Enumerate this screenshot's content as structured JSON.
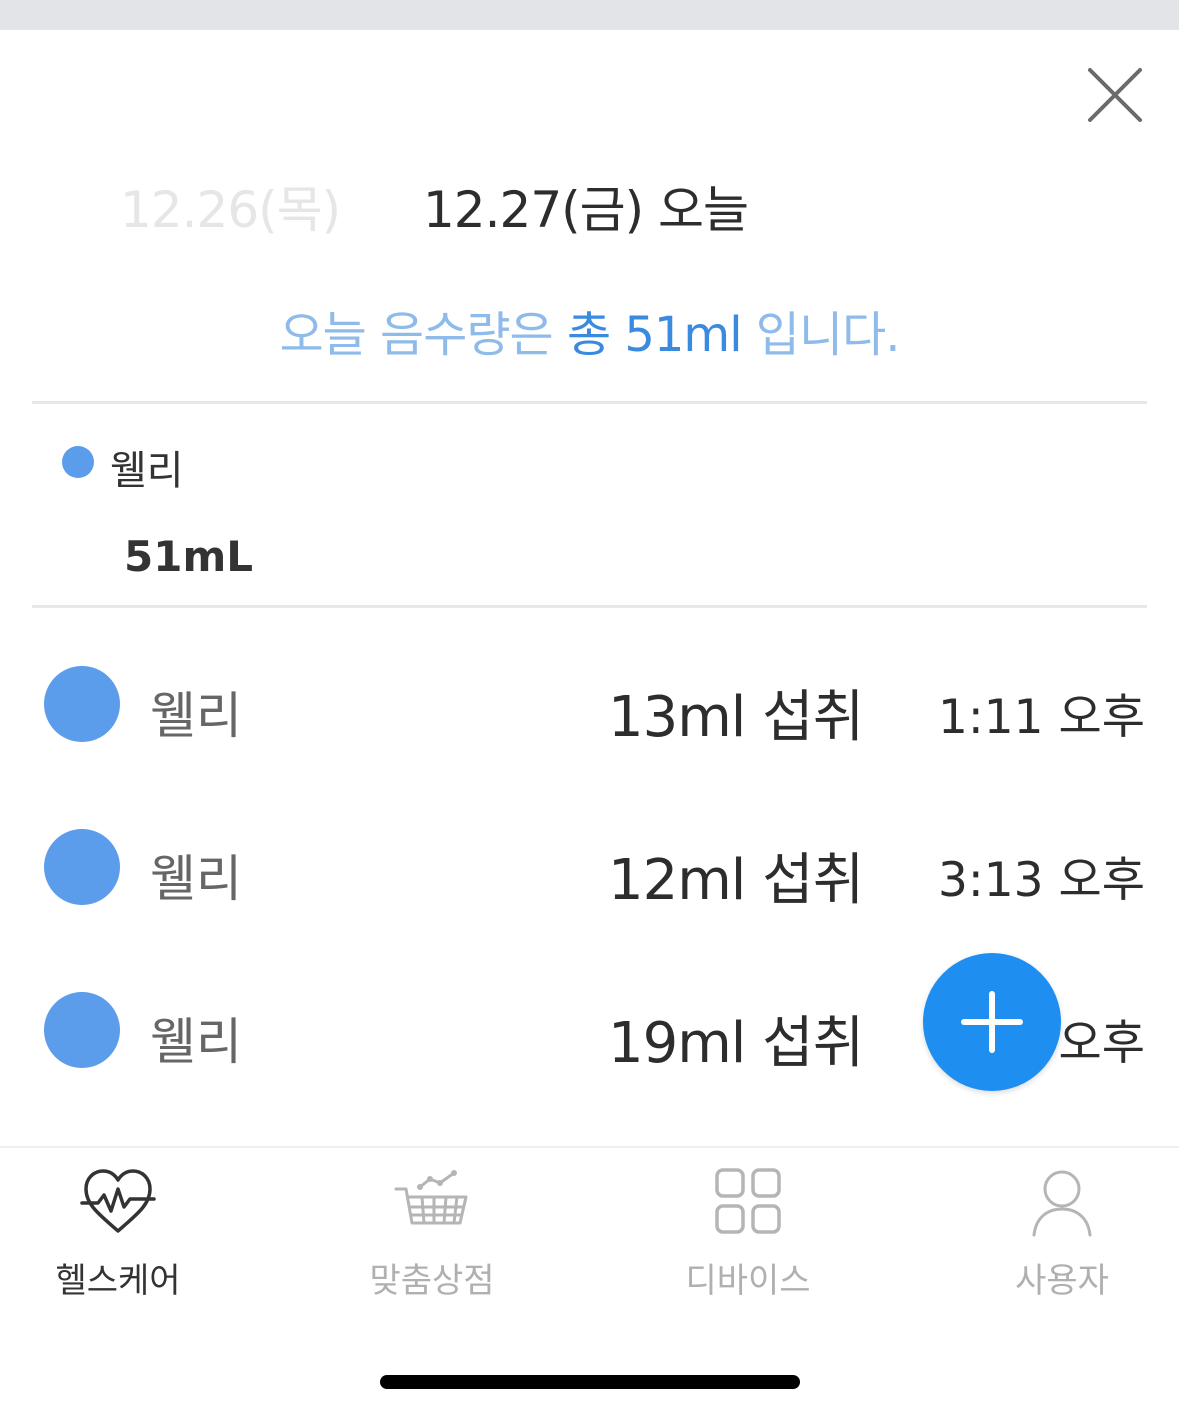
{
  "header": {
    "close_icon": "close-icon",
    "date_prev": "12.26(목)",
    "date_current": "12.27(금) 오늘"
  },
  "summary": {
    "prefix": "오늘 음수량은 ",
    "highlight": "총 51ml",
    "suffix": " 입니다."
  },
  "legend": {
    "name": "웰리",
    "total": "51mL",
    "color": "#5b9ceb"
  },
  "records": [
    {
      "name": "웰리",
      "amount": "13ml 섭취",
      "time": "1:11 오후"
    },
    {
      "name": "웰리",
      "amount": "12ml 섭취",
      "time": "3:13 오후"
    },
    {
      "name": "웰리",
      "amount": "19ml 섭취",
      "time": "오후"
    }
  ],
  "fab": {
    "icon": "plus-icon",
    "color": "#1e8ff0"
  },
  "tabs": [
    {
      "label": "헬스케어",
      "icon": "heart-pulse-icon",
      "active": true
    },
    {
      "label": "맞춤상점",
      "icon": "basket-icon",
      "active": false
    },
    {
      "label": "디바이스",
      "icon": "grid-icon",
      "active": false
    },
    {
      "label": "사용자",
      "icon": "user-icon",
      "active": false
    }
  ],
  "colors": {
    "accent": "#3a8ae0",
    "accent_light": "#8fbbea",
    "dot": "#5b9ceb"
  }
}
